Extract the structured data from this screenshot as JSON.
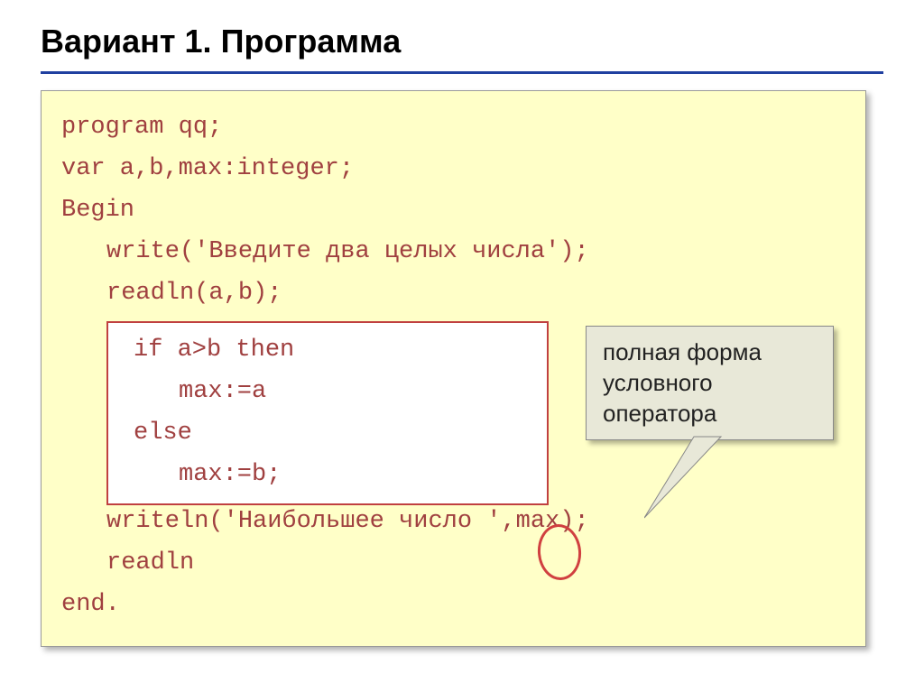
{
  "title": "Вариант 1. Программа",
  "code": {
    "l1": "program qq;",
    "l2": "var a,b,max:integer;",
    "l3": "Begin",
    "l4": "write('Введите два целых числа');",
    "l5": "readln(a,b);",
    "l6": "if a>b then",
    "l7": "max:=a",
    "l8": "else",
    "l9": "max:=b;",
    "l10": "writeln('Наибольшее число ',max);",
    "l11": "readln",
    "l12": "end."
  },
  "callout": {
    "text": "полная форма условного оператора"
  }
}
